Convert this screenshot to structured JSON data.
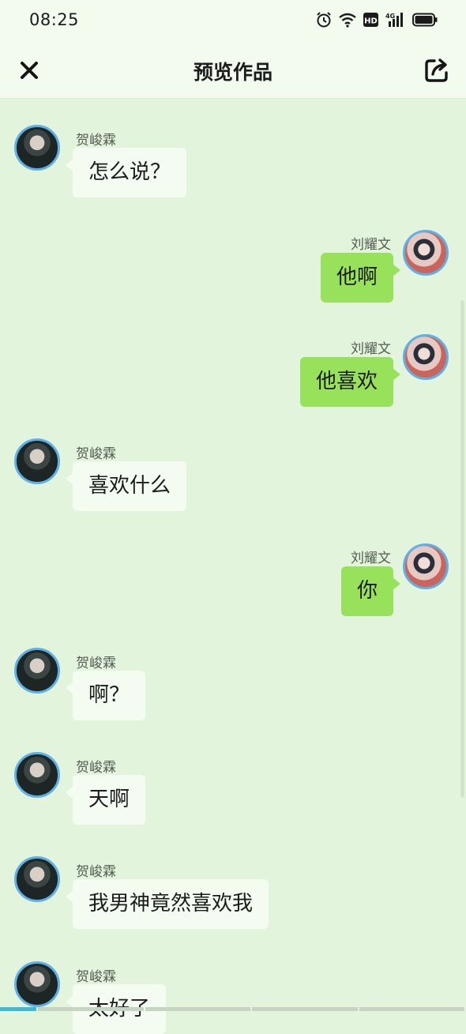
{
  "status": {
    "time": "08:25",
    "icons": [
      "alarm-icon",
      "wifi-icon",
      "hd-icon",
      "signal-4g-icon",
      "battery-icon"
    ],
    "network_label": "4G",
    "hd_label": "HD"
  },
  "header": {
    "title": "预览作品",
    "close_icon": "close-icon",
    "share_icon": "share-icon"
  },
  "colors": {
    "background": "#e3f4dc",
    "bubble_left": "#f4fbf1",
    "bubble_right": "#98e15a",
    "avatar_ring": "#5fb0e6"
  },
  "messages": [
    {
      "side": "left",
      "name": "贺峻霖",
      "text": "怎么说？"
    },
    {
      "side": "right",
      "name": "刘耀文",
      "text": "他啊"
    },
    {
      "side": "right",
      "name": "刘耀文",
      "text": "他喜欢"
    },
    {
      "side": "left",
      "name": "贺峻霖",
      "text": "喜欢什么"
    },
    {
      "side": "right",
      "name": "刘耀文",
      "text": "你"
    },
    {
      "side": "left",
      "name": "贺峻霖",
      "text": "啊？"
    },
    {
      "side": "left",
      "name": "贺峻霖",
      "text": "天啊"
    },
    {
      "side": "left",
      "name": "贺峻霖",
      "text": "我男神竟然喜欢我"
    },
    {
      "side": "left",
      "name": "贺峻霖",
      "text": "太好了"
    }
  ]
}
